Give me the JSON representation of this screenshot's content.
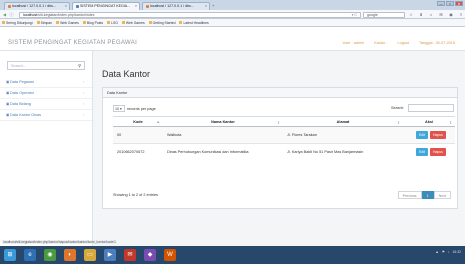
{
  "browser": {
    "tabs": [
      {
        "title": "localhost / 127.0.0.1 / dbs...",
        "active": false
      },
      {
        "title": "SISTEM PENGINGAT KEGIA...",
        "active": true
      },
      {
        "title": "localhost / 127.0.0.1 / dbs...",
        "active": false
      }
    ],
    "new_tab": "+",
    "window_buttons": {
      "minimize": "—",
      "maximize": "□",
      "close": "✕"
    },
    "address": {
      "host": "localhost",
      "path": "/siti-kegiatan/index.php/kantor/index",
      "dropdown": "▾ C"
    },
    "search": {
      "value": "google"
    },
    "toolbar_icons": [
      "☆",
      "⬇",
      "⌂",
      "✉",
      "◉",
      "≡"
    ],
    "bookmarks": [
      "Sering Dikunjungi",
      "Simpan",
      "Web Games",
      "Blog Posts",
      "LSG",
      "Web Games",
      "Getting Started",
      "Latest Headlines"
    ]
  },
  "app": {
    "brand": "SISTEM PENGINGAT KEGIATAN PEGAWAI",
    "user": {
      "user_label": "User : admin",
      "kantor_label": "Kantor :",
      "logout": "Logout",
      "date": "Tanggal : 30-07-2015"
    },
    "sidebar": {
      "search_placeholder": "Search...",
      "items": [
        {
          "label": "Data Pegawai",
          "icon": "users-icon"
        },
        {
          "label": "Data Operator",
          "icon": "user-icon"
        },
        {
          "label": "Data Bidang",
          "icon": "table-icon"
        },
        {
          "label": "Data Kantor Dinas",
          "icon": "building-icon"
        }
      ]
    },
    "main": {
      "title": "Data Kantor",
      "panel_title": "Data Kantor",
      "per_page_value": "10",
      "per_page_label": "records per page",
      "search_label": "Search:",
      "columns": [
        "Kode",
        "Nama Kantor",
        "Alamat",
        "Aksi"
      ],
      "rows": [
        {
          "kode": "00",
          "nama": "Walikota",
          "alamat": "Jl. Flores Tarakan"
        },
        {
          "kode": "2010662070672",
          "nama": "Dinas Perhubungan Komunikasi dan Informatika",
          "alamat": "Jl. Kariya Bakti No 51 Pasir Mas Banjarmasin"
        }
      ],
      "edit_label": "Edit",
      "delete_label": "Hapus",
      "info": "Showing 1 to 2 of 2 entries",
      "pager": {
        "prev": "Previous",
        "current": "1",
        "next": "Next"
      }
    },
    "status_url": "localhost/siti-kegiatan/index.php/kantor/hapus/kantor/kantor/kode_kantor/kode/1"
  },
  "taskbar": {
    "apps": [
      {
        "icon": "windows-icon",
        "glyph": "⊞",
        "color": "#3a9ad9"
      },
      {
        "icon": "ie-icon",
        "glyph": "e",
        "color": "#2f6fb3"
      },
      {
        "icon": "chrome-icon",
        "glyph": "◉",
        "color": "#4a9a3e"
      },
      {
        "icon": "firefox-icon",
        "glyph": "◐",
        "color": "#e0762c"
      },
      {
        "icon": "folder-icon",
        "glyph": "▭",
        "color": "#d8a93a"
      },
      {
        "icon": "media-icon",
        "glyph": "▶",
        "color": "#4c7fbf"
      },
      {
        "icon": "mail-icon",
        "glyph": "✉",
        "color": "#c0392b"
      },
      {
        "icon": "app-icon",
        "glyph": "◆",
        "color": "#7a4bb0"
      },
      {
        "icon": "office-icon",
        "glyph": "W",
        "color": "#d35400"
      }
    ],
    "tray": [
      "▲",
      "⚑",
      "♪",
      "16:32"
    ]
  }
}
